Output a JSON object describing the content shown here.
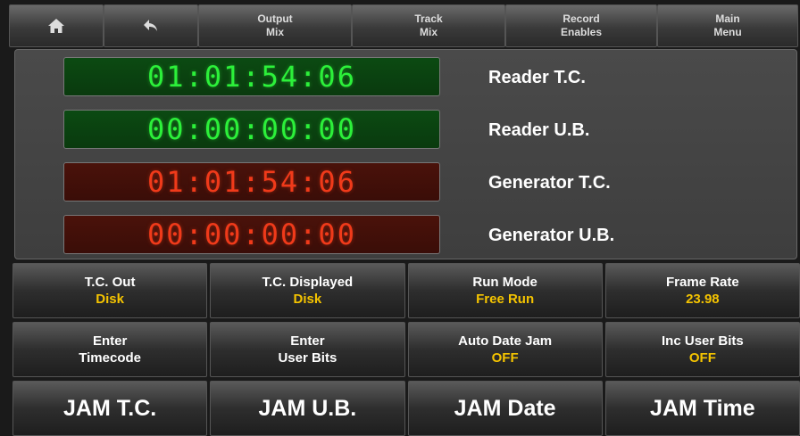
{
  "topbar": {
    "home_icon": "home-icon",
    "back_icon": "back-arrow-icon",
    "output_mix": [
      "Output",
      "Mix"
    ],
    "track_mix": [
      "Track",
      "Mix"
    ],
    "record_enables": [
      "Record",
      "Enables"
    ],
    "main_menu": [
      "Main",
      "Menu"
    ]
  },
  "timecode": {
    "reader_tc": "01:01:54:06",
    "reader_ub": "00:00:00:00",
    "generator_tc": "01:01:54:06",
    "generator_ub": "00:00:00:00",
    "reader_tc_label": "Reader T.C.",
    "reader_ub_label": "Reader U.B.",
    "generator_tc_label": "Generator T.C.",
    "generator_ub_label": "Generator U.B."
  },
  "settings": {
    "tc_out": {
      "label": "T.C. Out",
      "value": "Disk"
    },
    "tc_displayed": {
      "label": "T.C. Displayed",
      "value": "Disk"
    },
    "run_mode": {
      "label": "Run Mode",
      "value": "Free Run"
    },
    "frame_rate": {
      "label": "Frame Rate",
      "value": "23.98"
    },
    "enter_timecode": [
      "Enter",
      "Timecode"
    ],
    "enter_user_bits": [
      "Enter",
      "User Bits"
    ],
    "auto_date_jam": {
      "label": "Auto Date Jam",
      "value": "OFF"
    },
    "inc_user_bits": {
      "label": "Inc User Bits",
      "value": "OFF"
    }
  },
  "jam": {
    "jam_tc": "JAM T.C.",
    "jam_ub": "JAM U.B.",
    "jam_date": "JAM Date",
    "jam_time": "JAM Time"
  },
  "colors": {
    "reader_digits": "#2cf03a",
    "generator_digits": "#f03a1a",
    "value_text": "#f5c400"
  }
}
